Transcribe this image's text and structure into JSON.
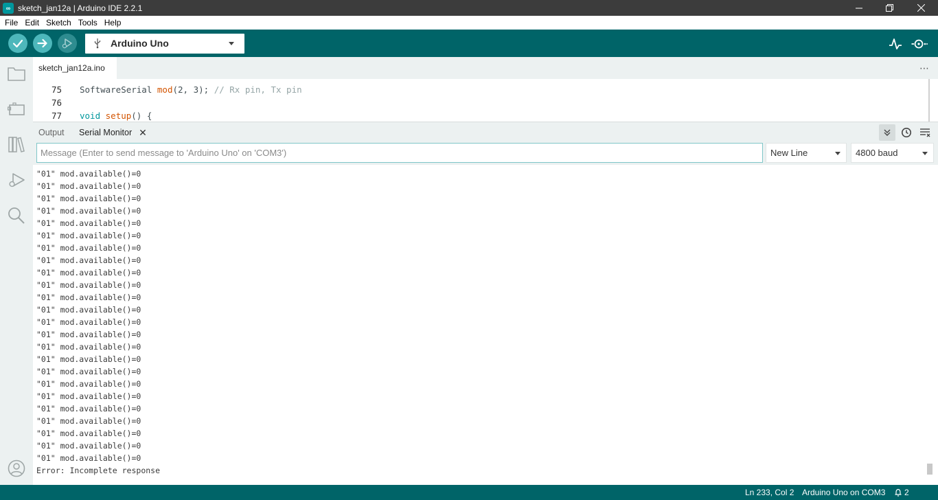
{
  "window": {
    "title": "sketch_jan12a | Arduino IDE 2.2.1",
    "icon": "arduino-logo-icon"
  },
  "menu": {
    "items": [
      "File",
      "Edit",
      "Sketch",
      "Tools",
      "Help"
    ]
  },
  "toolbar": {
    "verify_icon": "checkmark-icon",
    "upload_icon": "arrow-right-icon",
    "debug_icon": "debug-icon",
    "board_name": "Arduino Uno",
    "serial_plotter_icon": "pulse-icon",
    "serial_monitor_icon": "serial-monitor-icon",
    "accent_color": "#006468"
  },
  "sidebar": {
    "icons": [
      "folder-icon",
      "boards-manager-icon",
      "library-icon",
      "debug-icon",
      "search-icon",
      "account-icon"
    ]
  },
  "editor": {
    "tab_label": "sketch_jan12a.ino",
    "more_label": "⋯",
    "lines": [
      {
        "num": "75",
        "before": "SoftwareSerial ",
        "fn": "mod",
        "after": "(2, 3); ",
        "comment": "// Rx pin, Tx pin"
      },
      {
        "num": "76",
        "before": "",
        "fn": "",
        "after": "",
        "comment": ""
      },
      {
        "num": "77",
        "kw": "void",
        "before": " ",
        "fn": "setup",
        "after": "() {",
        "comment": ""
      }
    ]
  },
  "panel": {
    "tabs": [
      "Output",
      "Serial Monitor"
    ],
    "active_tab": "Serial Monitor",
    "message_placeholder": "Message (Enter to send message to 'Arduino Uno' on 'COM3')",
    "line_ending": "New Line",
    "baud_rate": "4800 baud"
  },
  "serial_output": {
    "lines": [
      "\"01\" mod.available()=0",
      "\"01\" mod.available()=0",
      "\"01\" mod.available()=0",
      "\"01\" mod.available()=0",
      "\"01\" mod.available()=0",
      "\"01\" mod.available()=0",
      "\"01\" mod.available()=0",
      "\"01\" mod.available()=0",
      "\"01\" mod.available()=0",
      "\"01\" mod.available()=0",
      "\"01\" mod.available()=0",
      "\"01\" mod.available()=0",
      "\"01\" mod.available()=0",
      "\"01\" mod.available()=0",
      "\"01\" mod.available()=0",
      "\"01\" mod.available()=0",
      "\"01\" mod.available()=0",
      "\"01\" mod.available()=0",
      "\"01\" mod.available()=0",
      "\"01\" mod.available()=0",
      "\"01\" mod.available()=0",
      "\"01\" mod.available()=0",
      "\"01\" mod.available()=0",
      "\"01\" mod.available()=0",
      "Error: Incomplete response"
    ]
  },
  "status": {
    "cursor": "Ln 233, Col 2",
    "board_port": "Arduino Uno on COM3",
    "notification_count": "2"
  }
}
